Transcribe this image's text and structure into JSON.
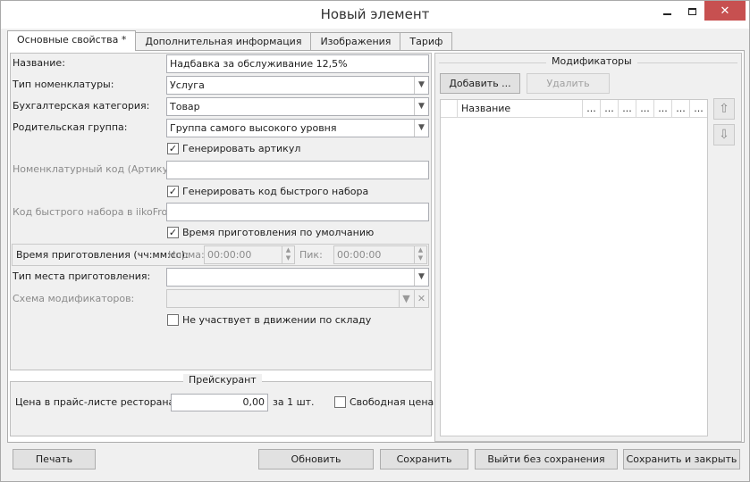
{
  "window": {
    "title": "Новый элемент",
    "controls": {
      "minimize_icon": "minimize-icon",
      "maximize_icon": "maximize-icon",
      "close_icon": "close-icon",
      "close_glyph": "✕",
      "close_color": "#c75050"
    }
  },
  "tabs": [
    {
      "label": "Основные свойства *",
      "active": true
    },
    {
      "label": "Дополнительная информация",
      "active": false
    },
    {
      "label": "Изображения",
      "active": false
    },
    {
      "label": "Тариф",
      "active": false
    }
  ],
  "form": {
    "name_label": "Название:",
    "name_value": "Надбавка за обслуживание 12,5%",
    "type_label": "Тип номенклатуры:",
    "type_value": "Услуга",
    "accounting_label": "Бухгалтерская категория:",
    "accounting_value": "Товар",
    "parent_label": "Родительская группа:",
    "parent_value": "Группа самого высокого уровня",
    "gen_article_label": "Генерировать артикул",
    "gen_article_checked": true,
    "article_label": "Номенклатурный код (Артикул):",
    "article_value": "",
    "gen_quickcode_label": "Генерировать код быстрого набора",
    "gen_quickcode_checked": true,
    "quickcode_label": "Код быстрого набора в iikoFront:",
    "quickcode_value": "",
    "default_cooktime_label": "Время приготовления по умолчанию",
    "default_cooktime_checked": true,
    "cooktime_label": "Время приготовления (чч:мм:сс):",
    "norm_label": "Норма:",
    "norm_value": "00:00:00",
    "peak_label": "Пик:",
    "peak_value": "00:00:00",
    "place_type_label": "Тип места приготовления:",
    "place_type_value": "",
    "modifier_scheme_label": "Схема модификаторов:",
    "modifier_scheme_value": "",
    "no_stock_label": "Не участвует в движении по складу",
    "no_stock_checked": false,
    "check_glyph": "✓",
    "dropdown_glyph": "▼",
    "clear_glyph": "✕",
    "spin_up_glyph": "▲",
    "spin_down_glyph": "▼"
  },
  "price": {
    "group_title": "Прейскурант",
    "price_label": "Цена в прайс-листе ресторана:",
    "price_value": "0,00",
    "per_unit": "за 1 шт.",
    "free_price_label": "Свободная цена",
    "free_price_checked": false
  },
  "modifiers": {
    "group_title": "Модификаторы",
    "add_button": "Добавить ...",
    "delete_button": "Удалить",
    "columns": [
      "",
      "Название",
      "...",
      "...",
      "...",
      "...",
      "...",
      "...",
      "..."
    ],
    "up_glyph": "⇧",
    "down_glyph": "⇩"
  },
  "footer": {
    "print": "Печать",
    "refresh": "Обновить",
    "save": "Сохранить",
    "exit_no_save": "Выйти без сохранения",
    "save_close": "Сохранить и закрыть"
  }
}
